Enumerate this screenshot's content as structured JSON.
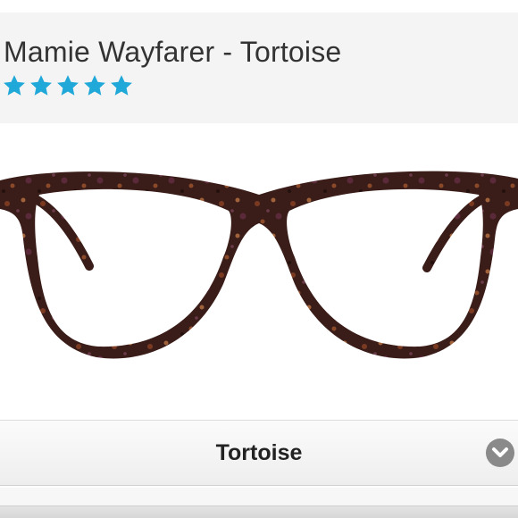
{
  "product": {
    "title": "Mamie Wayfarer - Tortoise",
    "rating_stars": 5,
    "star_color": "#1fa8d8"
  },
  "image": {
    "subject": "glasses-image",
    "frame_color": "#3a1c18"
  },
  "color_selector": {
    "selected_value": "Tortoise",
    "icon": "chevron-down-icon"
  }
}
